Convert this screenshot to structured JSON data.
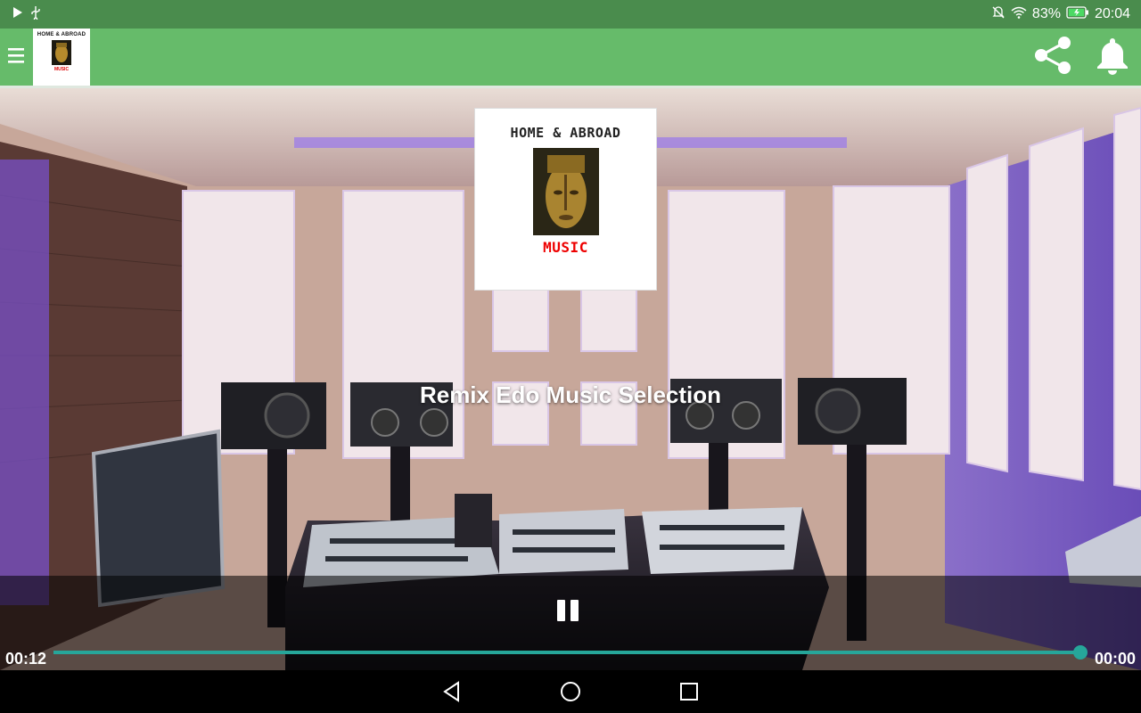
{
  "status_bar": {
    "battery_text": "83%",
    "time": "20:04",
    "icons": [
      "play-icon",
      "usb-icon",
      "mute-icon",
      "wifi-icon",
      "battery-charging-icon"
    ]
  },
  "app_bar": {
    "logo": {
      "top_text": "HOME & ABROAD",
      "bottom_text": "MUSIC"
    },
    "icons": [
      "menu-icon",
      "share-icon",
      "bell-icon"
    ],
    "accent_color": "#66bb6a"
  },
  "album": {
    "cover_title": "HOME & ABROAD",
    "cover_subtitle": "MUSIC"
  },
  "player": {
    "track_title": "Remix Edo Music Selection",
    "elapsed": "00:12",
    "total": "00:00",
    "progress_fraction": 1.0,
    "seek_color": "#26a69a"
  },
  "nav_bar": {
    "icons": [
      "back-icon",
      "home-icon",
      "recents-icon"
    ]
  }
}
